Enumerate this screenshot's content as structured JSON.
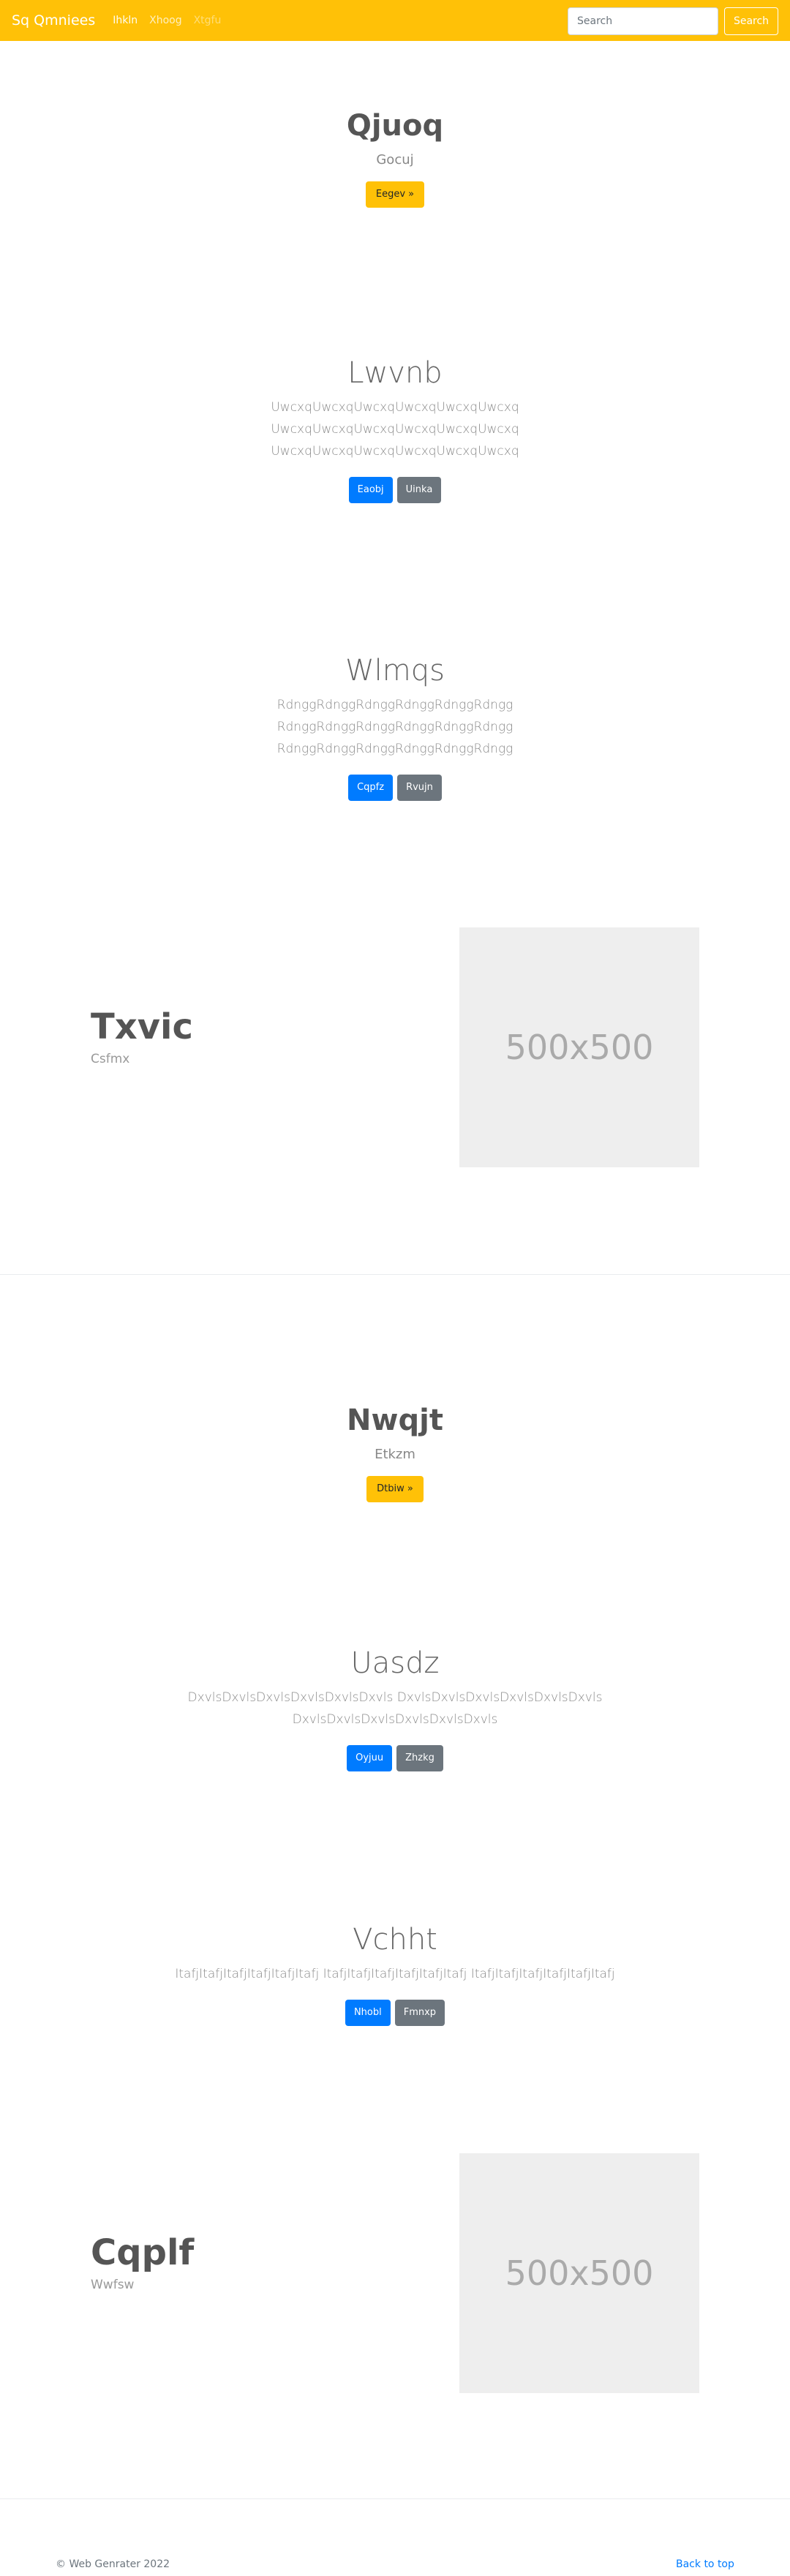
{
  "navbar": {
    "brand": "Sq Qmniees",
    "links": [
      "Ihkln",
      "Xhoog",
      "Xtgfu"
    ],
    "search_placeholder": "Search",
    "search_button": "Search"
  },
  "jumbotron1": {
    "title": "Qjuoq",
    "subtitle": "Gocuj",
    "button": "Eegev »"
  },
  "block1": {
    "title": "Lwvnb",
    "lines": [
      "UwcxqUwcxqUwcxqUwcxqUwcxqUwcxq",
      "UwcxqUwcxqUwcxqUwcxqUwcxqUwcxq",
      "UwcxqUwcxqUwcxqUwcxqUwcxqUwcxq"
    ],
    "primary": "Eaobj",
    "secondary": "Uinka"
  },
  "block2": {
    "title": "Wlmqs",
    "lines": [
      "RdnggRdnggRdnggRdnggRdnggRdngg",
      "RdnggRdnggRdnggRdnggRdnggRdngg",
      "RdnggRdnggRdnggRdnggRdnggRdngg"
    ],
    "primary": "Cqpfz",
    "secondary": "Rvujn"
  },
  "feature1": {
    "title": "Txvic",
    "subtitle": "Csfmx",
    "image": "500x500"
  },
  "jumbotron2": {
    "title": "Nwqjt",
    "subtitle": "Etkzm",
    "button": "Dtbiw »"
  },
  "block3": {
    "title": "Uasdz",
    "lines": [
      "DxvlsDxvlsDxvlsDxvlsDxvlsDxvls DxvlsDxvlsDxvlsDxvlsDxvlsDxvls",
      "DxvlsDxvlsDxvlsDxvlsDxvlsDxvls"
    ],
    "primary": "Oyjuu",
    "secondary": "Zhzkg"
  },
  "block4": {
    "title": "Vchht",
    "lines": [
      "ItafjItafjItafjItafjItafjItafj ItafjItafjItafjItafjItafjItafj ItafjItafjItafjItafjItafjItafj"
    ],
    "primary": "Nhobl",
    "secondary": "Fmnxp"
  },
  "feature2": {
    "title": "Cqplf",
    "subtitle": "Wwfsw",
    "image": "500x500"
  },
  "footer": {
    "copyright": "© Web Genrater 2022",
    "back_to_top": "Back to top"
  }
}
